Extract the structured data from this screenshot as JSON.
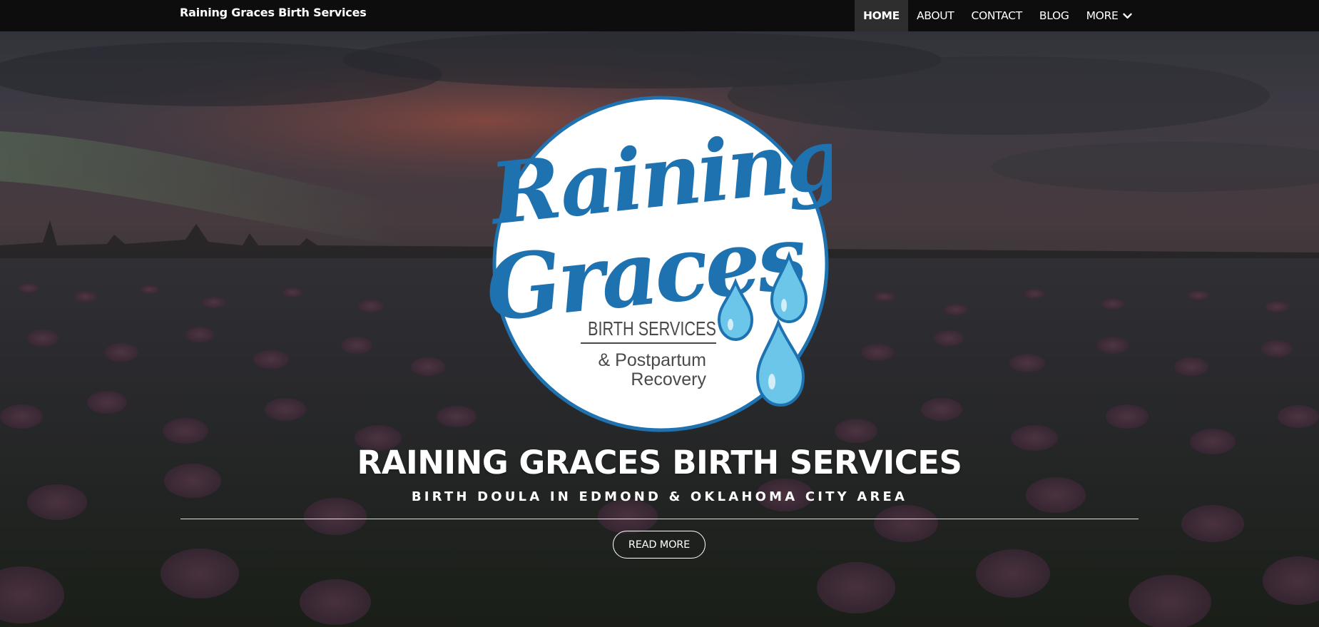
{
  "header": {
    "brand": "Raining Graces Birth Services",
    "nav": [
      {
        "label": "HOME",
        "active": true
      },
      {
        "label": "ABOUT",
        "active": false
      },
      {
        "label": "CONTACT",
        "active": false
      },
      {
        "label": "BLOG",
        "active": false
      },
      {
        "label": "MORE",
        "active": false,
        "icon": "chevron-down-icon"
      }
    ]
  },
  "logo": {
    "script_line1": "Raining",
    "script_line2": "Graces",
    "line3": "BIRTH SERVICES",
    "line4": "& Postpartum",
    "line5": "Recovery",
    "colors": {
      "blue": "#1f72b0",
      "light_blue": "#6cc6ea",
      "gray_text": "#4a4a4a"
    }
  },
  "hero": {
    "title": "RAINING GRACES BIRTH SERVICES",
    "subtitle": "BIRTH DOULA IN EDMOND & OKLAHOMA CITY AREA",
    "cta": "READ MORE",
    "background": "dark-overlay-poppy-field-at-sunset"
  }
}
